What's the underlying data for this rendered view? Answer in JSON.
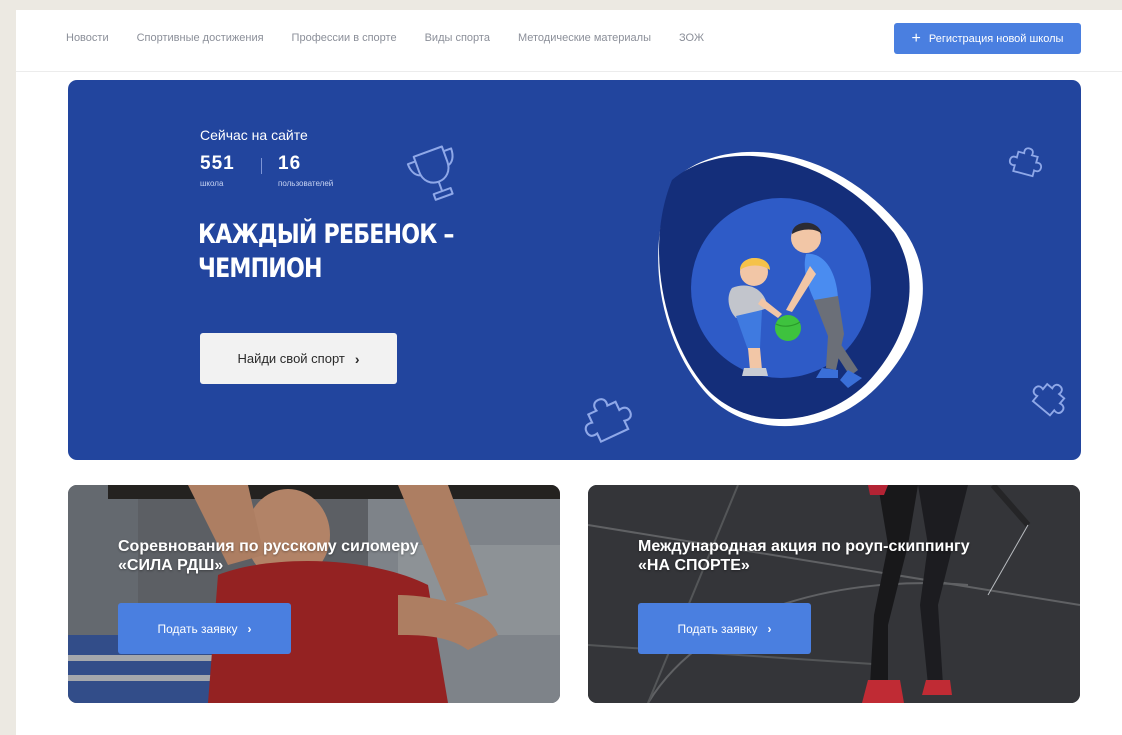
{
  "nav": {
    "links": [
      "Новости",
      "Спортивные достижения",
      "Профессии в спорте",
      "Виды спорта",
      "Методические материалы",
      "ЗОЖ"
    ],
    "register_plus": "+",
    "register_label": "Регистрация новой школы"
  },
  "hero": {
    "online_label": "Сейчас на сайте",
    "stats": [
      {
        "value": "551",
        "caption": "школа"
      },
      {
        "value": "16",
        "caption": "пользователей"
      }
    ],
    "title_line1": "КАЖДЫЙ РЕБЕНОК –",
    "title_line2": "ЧЕМПИОН",
    "cta_label": "Найди свой спорт",
    "cta_chevron": "›"
  },
  "cards": [
    {
      "title_line1": "Соревнования по русскому силомеру",
      "title_line2": "«СИЛА РДШ»",
      "button_label": "Подать заявку",
      "chevron": "›"
    },
    {
      "title_line1": "Международная акция по роуп-скиппингу",
      "title_line2": "«НА СПОРТЕ»",
      "button_label": "Подать заявку",
      "chevron": "›"
    }
  ],
  "icons": [
    "trophy-icon",
    "puzzle-icon",
    "chevron-right-icon",
    "plus-icon"
  ],
  "colors": {
    "accent": "#4a7fe0",
    "hero_bg": "#22459e",
    "page_bg": "#ffffff"
  }
}
